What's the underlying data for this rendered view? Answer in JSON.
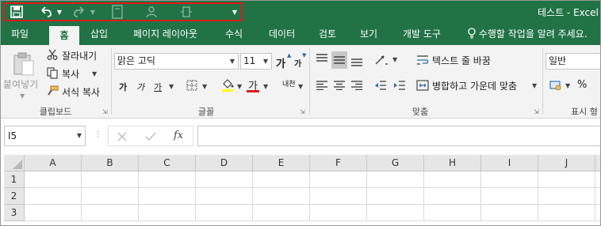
{
  "title": "테스트 - Excel",
  "tabs": [
    {
      "label": "파일"
    },
    {
      "label": "홈"
    },
    {
      "label": "삽입"
    },
    {
      "label": "페이지 레이아웃"
    },
    {
      "label": "수식"
    },
    {
      "label": "데이터"
    },
    {
      "label": "검토"
    },
    {
      "label": "보기"
    },
    {
      "label": "개발 도구"
    }
  ],
  "tell_me": "수행할 작업을 알려 주세요.",
  "clipboard": {
    "paste": "붙여넣기",
    "cut": "잘라내기",
    "copy": "복사",
    "format_painter": "서식 복사",
    "label": "클립보드"
  },
  "font": {
    "name": "맑은 고딕",
    "size": "11",
    "grow": "가",
    "shrink": "가",
    "bold": "가",
    "italic": "가",
    "underline": "가",
    "font_color": "가",
    "phonetic": "내천",
    "label": "글꼴"
  },
  "alignment": {
    "wrap_text": "텍스트 줄 바꿈",
    "merge_center": "병합하고 가운데 맞춤",
    "label": "맞춤"
  },
  "number": {
    "format": "일반",
    "percent": "%",
    "label": "표시 형"
  },
  "name_box": "I5",
  "formula_icon": "fx",
  "columns": [
    "A",
    "B",
    "C",
    "D",
    "E",
    "F",
    "G",
    "H",
    "I",
    "J"
  ],
  "rows": [
    "1",
    "2",
    "3"
  ],
  "colors": {
    "brand": "#217346",
    "highlight": "#ffff00",
    "font_red": "#e0191b",
    "qat_border": "#e0191b"
  }
}
